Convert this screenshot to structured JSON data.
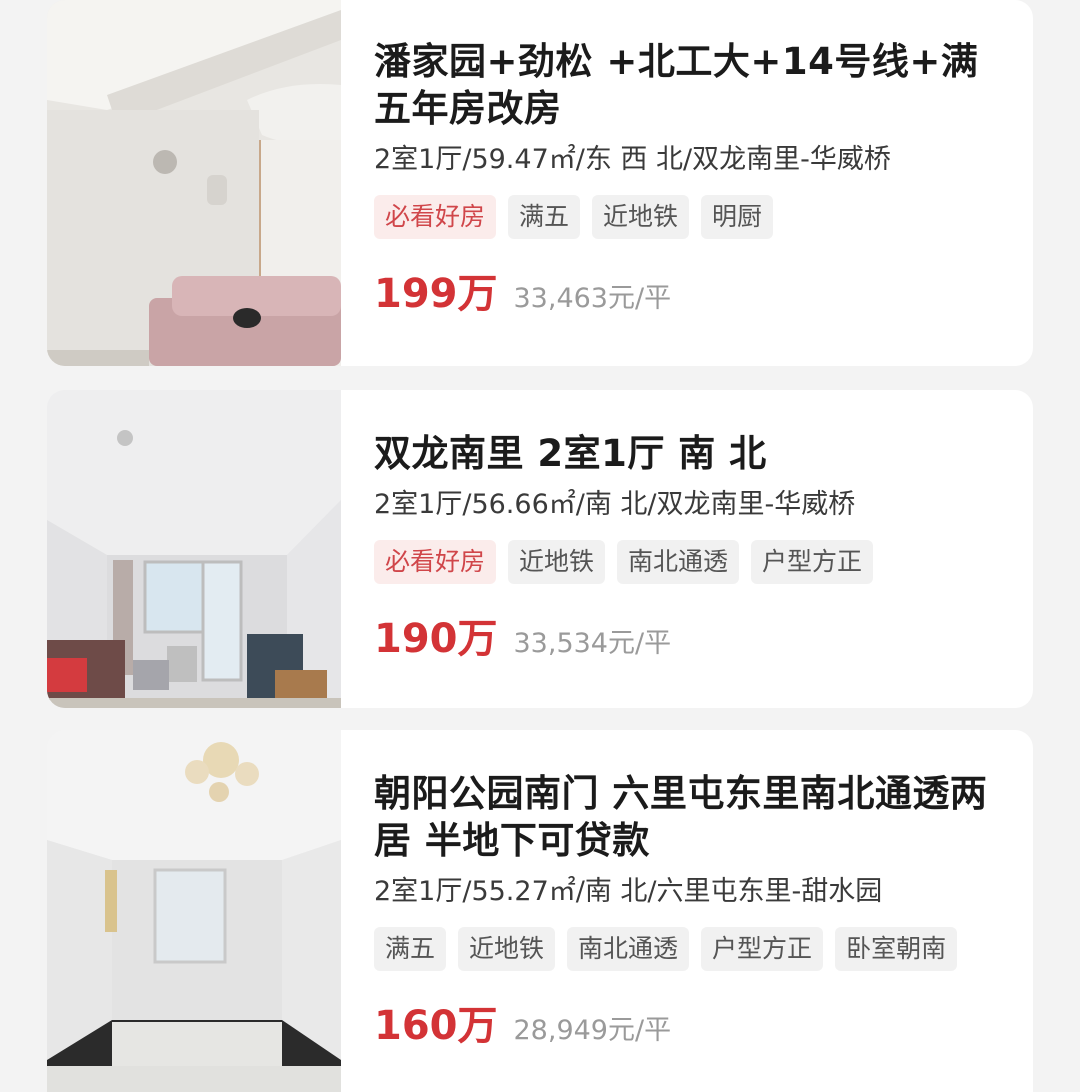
{
  "listings": [
    {
      "title": "潘家园+劲松 +北工大+14号线+满五年房改房",
      "meta": "2室1厅/59.47㎡/东 西 北/双龙南里-华威桥",
      "tags": [
        "必看好房",
        "满五",
        "近地铁",
        "明厨"
      ],
      "price": "199万",
      "unit_price": "33,463元/平"
    },
    {
      "title": "双龙南里 2室1厅 南 北",
      "meta": "2室1厅/56.66㎡/南 北/双龙南里-华威桥",
      "tags": [
        "必看好房",
        "近地铁",
        "南北通透",
        "户型方正"
      ],
      "price": "190万",
      "unit_price": "33,534元/平"
    },
    {
      "title": "朝阳公园南门 六里屯东里南北通透两居 半地下可贷款",
      "meta": "2室1厅/55.27㎡/南 北/六里屯东里-甜水园",
      "tags": [
        "满五",
        "近地铁",
        "南北通透",
        "户型方正",
        "卧室朝南"
      ],
      "price": "160万",
      "unit_price": "28,949元/平"
    }
  ],
  "colors": {
    "price_red": "#d33336",
    "hot_tag_text": "#d0464a",
    "hot_tag_bg": "#fbeceb",
    "tag_bg": "#f1f1f1"
  }
}
